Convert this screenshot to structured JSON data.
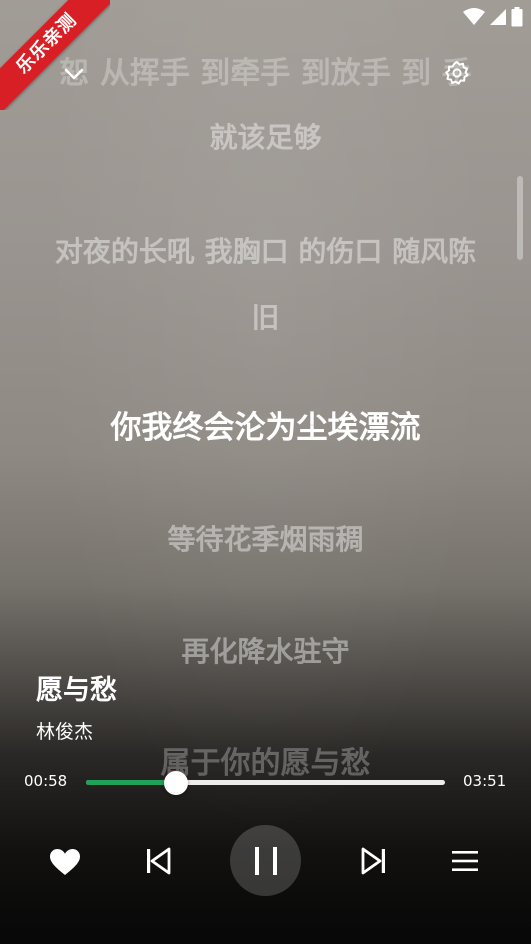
{
  "watermark": {
    "text": "乐乐亲测",
    "color": "#d81f26"
  },
  "status_bar": {
    "icons": [
      "wifi-icon",
      "signal-icon",
      "battery-icon"
    ]
  },
  "lyrics": {
    "lines": [
      {
        "text": "恕  从挥手 到牵手 到放手 到  手",
        "state": "partial"
      },
      {
        "text": "就该足够",
        "state": "inactive"
      },
      {
        "text": "对夜的长吼 我胸口 的伤口 随风陈",
        "state": "inactive"
      },
      {
        "text": "旧",
        "state": "inactive"
      },
      {
        "text": "你我终会沦为尘埃漂流",
        "state": "active"
      },
      {
        "text": "等待花季烟雨稠",
        "state": "inactive"
      },
      {
        "text": "再化降水驻守",
        "state": "inactive"
      },
      {
        "text": "属于你的愿与愁",
        "state": "partial"
      }
    ]
  },
  "song": {
    "title": "愿与愁",
    "artist": "林俊杰"
  },
  "player": {
    "current_time": "00:58",
    "total_time": "03:51",
    "progress": 0.251,
    "progress_color": "#1fa157",
    "state": "playing"
  },
  "controls": {
    "icons": [
      "heart-icon",
      "skip-previous-icon",
      "pause-icon",
      "skip-next-icon",
      "playlist-icon"
    ]
  },
  "topbar": {
    "icons": [
      "chevron-down-icon",
      "gear-icon"
    ]
  }
}
